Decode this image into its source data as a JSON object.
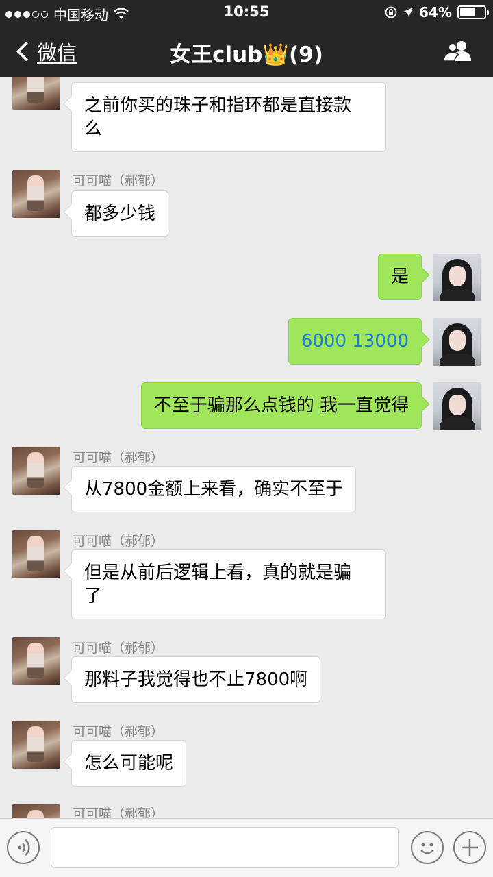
{
  "status_bar": {
    "carrier": "中国移动",
    "time": "10:55",
    "battery": "64%",
    "battery_level": 0.64
  },
  "nav": {
    "back_label": "微信",
    "title": "女王club👑(9)"
  },
  "messages": [
    {
      "side": "left",
      "name": "",
      "text": "之前你买的珠子和指环都是直接款\n么"
    },
    {
      "side": "left",
      "name": "可可喵（郝郁）",
      "text": "都多少钱"
    },
    {
      "side": "right",
      "text": "是"
    },
    {
      "side": "right",
      "text": "6000 13000"
    },
    {
      "side": "right",
      "text": "不至于骗那么点钱的 我一直觉得"
    },
    {
      "side": "left",
      "name": "可可喵（郝郁）",
      "text": "从7800金额上来看，确实不至于"
    },
    {
      "side": "left",
      "name": "可可喵（郝郁）",
      "text": "但是从前后逻辑上看，真的就是骗\n了"
    },
    {
      "side": "left",
      "name": "可可喵（郝郁）",
      "text": "那料子我觉得也不止7800啊"
    },
    {
      "side": "left",
      "name": "可可喵（郝郁）",
      "text": "怎么可能呢"
    },
    {
      "side": "left",
      "name": "可可喵（郝郁）",
      "text": ""
    }
  ],
  "icons": {
    "back": "chevron-left-icon",
    "contacts": "contacts-icon",
    "voice": "voice-icon",
    "emoji": "emoji-icon",
    "plus": "plus-icon"
  },
  "colors": {
    "navbar": "#262626",
    "chat_bg": "#ebebeb",
    "bubble_sent": "#9fe65a",
    "bubble_received": "#ffffff",
    "number_link": "#1a7fd4"
  }
}
